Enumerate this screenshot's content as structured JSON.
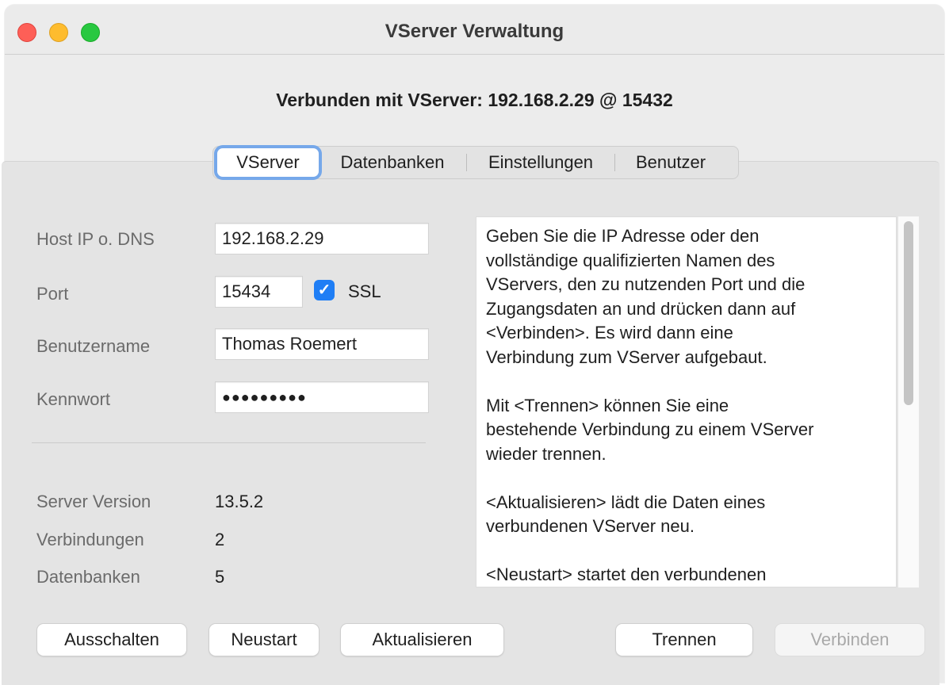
{
  "window": {
    "title": "VServer Verwaltung"
  },
  "status": {
    "text": "Verbunden mit VServer: 192.168.2.29 @ 15432"
  },
  "tabs": [
    {
      "label": "VServer",
      "selected": true
    },
    {
      "label": "Datenbanken",
      "selected": false
    },
    {
      "label": "Einstellungen",
      "selected": false
    },
    {
      "label": "Benutzer",
      "selected": false
    }
  ],
  "form": {
    "host_label": "Host IP o. DNS",
    "host_value": "192.168.2.29",
    "port_label": "Port",
    "port_value": "15434",
    "ssl_label": "SSL",
    "ssl_checked": true,
    "user_label": "Benutzername",
    "user_value": "Thomas Roemert",
    "password_label": "Kennwort",
    "password_value": "●●●●●●●●●"
  },
  "info": {
    "version_label": "Server Version",
    "version_value": "13.5.2",
    "connections_label": "Verbindungen",
    "connections_value": "2",
    "databases_label": "Datenbanken",
    "databases_value": "5"
  },
  "help": {
    "text": "Geben Sie die IP Adresse oder den\nvollständige qualifizierten Namen des\nVServers, den zu nutzenden Port und die\nZugangsdaten an und drücken dann auf\n<Verbinden>. Es wird dann eine\nVerbindung zum VServer aufgebaut.\n\nMit <Trennen> können Sie eine\nbestehende Verbindung zu einem VServer\nwieder trennen.\n\n<Aktualisieren> lädt die Daten eines\nverbundenen VServer neu.\n\n<Neustart> startet den verbundenen"
  },
  "buttons": {
    "shutdown": "Ausschalten",
    "restart": "Neustart",
    "refresh": "Aktualisieren",
    "disconnect": "Trennen",
    "connect": "Verbinden"
  },
  "colors": {
    "accent": "#1f7ef5",
    "focus_ring": "#76a8ea",
    "close": "#fe5f57",
    "minimize": "#febc2e",
    "zoom": "#28c840"
  }
}
